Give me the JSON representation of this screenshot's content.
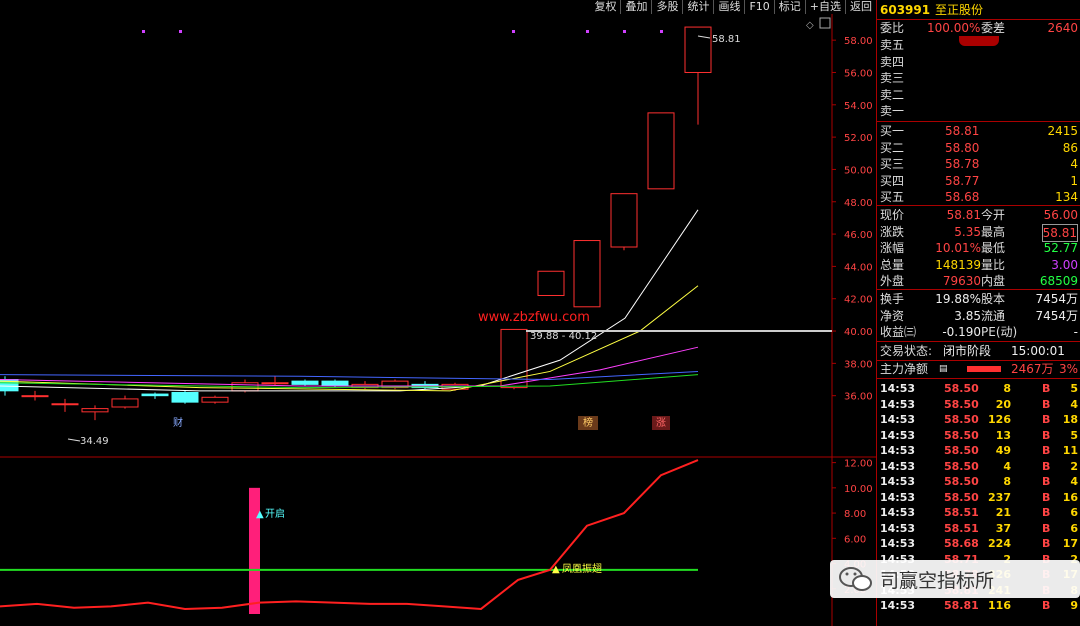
{
  "toolbar": [
    "复权",
    "叠加",
    "多股",
    "统计",
    "画线",
    "F10",
    "标记",
    "+自选",
    "返回"
  ],
  "stock": {
    "code": "603991",
    "name": "至正股份"
  },
  "order_ratio": {
    "label1": "委比",
    "value1": "100.00%",
    "label2": "委差",
    "value2": "2640"
  },
  "sell_levels": [
    "卖五",
    "卖四",
    "卖三",
    "卖二",
    "卖一"
  ],
  "buy_levels": [
    {
      "label": "买一",
      "price": "58.81",
      "vol": "2415"
    },
    {
      "label": "买二",
      "price": "58.80",
      "vol": "86"
    },
    {
      "label": "买三",
      "price": "58.78",
      "vol": "4"
    },
    {
      "label": "买四",
      "price": "58.77",
      "vol": "1"
    },
    {
      "label": "买五",
      "price": "58.68",
      "vol": "134"
    }
  ],
  "quote": [
    {
      "l1": "现价",
      "v1": "58.81",
      "l2": "今开",
      "v2": "56.00"
    },
    {
      "l1": "涨跌",
      "v1": "5.35",
      "l2": "最高",
      "v2": "58.81"
    },
    {
      "l1": "涨幅",
      "v1": "10.01%",
      "l2": "最低",
      "v2": "52.77"
    },
    {
      "l1": "总量",
      "v1": "148139",
      "l2": "量比",
      "v2": "3.00"
    },
    {
      "l1": "外盘",
      "v1": "79630",
      "l2": "内盘",
      "v2": "68509"
    }
  ],
  "fundamentals": [
    {
      "l1": "换手",
      "v1": "19.88%",
      "l2": "股本",
      "v2": "7454万"
    },
    {
      "l1": "净资",
      "v1": "3.85",
      "l2": "流通",
      "v2": "7454万"
    },
    {
      "l1": "收益㈢",
      "v1": "-0.190",
      "l2": "PE(动)",
      "v2": "-"
    }
  ],
  "trade_status": {
    "label": "交易状态:",
    "state": "闭市阶段",
    "time": "15:00:01"
  },
  "main_flow": {
    "label": "主力净额",
    "value": "2467万",
    "pct": "3%"
  },
  "ticks": [
    {
      "t": "14:53",
      "p": "58.50",
      "v": "8",
      "d": "B",
      "n": "5"
    },
    {
      "t": "14:53",
      "p": "58.50",
      "v": "20",
      "d": "B",
      "n": "4"
    },
    {
      "t": "14:53",
      "p": "58.50",
      "v": "126",
      "d": "B",
      "n": "18"
    },
    {
      "t": "14:53",
      "p": "58.50",
      "v": "13",
      "d": "B",
      "n": "5"
    },
    {
      "t": "14:53",
      "p": "58.50",
      "v": "49",
      "d": "B",
      "n": "11"
    },
    {
      "t": "14:53",
      "p": "58.50",
      "v": "4",
      "d": "B",
      "n": "2"
    },
    {
      "t": "14:53",
      "p": "58.50",
      "v": "8",
      "d": "B",
      "n": "4"
    },
    {
      "t": "14:53",
      "p": "58.50",
      "v": "237",
      "d": "B",
      "n": "16"
    },
    {
      "t": "14:53",
      "p": "58.51",
      "v": "21",
      "d": "B",
      "n": "6"
    },
    {
      "t": "14:53",
      "p": "58.51",
      "v": "37",
      "d": "B",
      "n": "6"
    },
    {
      "t": "14:53",
      "p": "58.68",
      "v": "224",
      "d": "B",
      "n": "17"
    },
    {
      "t": "14:53",
      "p": "58.71",
      "v": "2",
      "d": "B",
      "n": "2"
    },
    {
      "t": "14:53",
      "p": "58.79",
      "v": "326",
      "d": "B",
      "n": "17"
    },
    {
      "t": "14:53",
      "p": "58.81",
      "v": "241",
      "d": "B",
      "n": "8"
    },
    {
      "t": "14:53",
      "p": "58.81",
      "v": "116",
      "d": "B",
      "n": "9"
    }
  ],
  "price_axis": [
    "58.00",
    "56.00",
    "54.00",
    "52.00",
    "50.00",
    "48.00",
    "46.00",
    "44.00",
    "42.00",
    "40.00",
    "38.00",
    "36.00"
  ],
  "indicator_axis": [
    "12.00",
    "10.00",
    "8.00",
    "6.00",
    "4.00",
    "2.00"
  ],
  "chart_labels": {
    "high_label": "58.81",
    "low_label": "34.49",
    "range_label": "39.88 - 40.12",
    "site": "www.zbzfwu.com",
    "marker_cai": "财",
    "marker_bang": "榜",
    "marker_zhang": "涨",
    "signal_open": "开启",
    "signal_fly": "凤凰振翅"
  },
  "watermark": "司赢空指标所",
  "chart_data": {
    "type": "candlestick",
    "candles": [
      {
        "o": 37.0,
        "c": 36.3,
        "h": 37.2,
        "l": 36.0
      },
      {
        "o": 36.0,
        "c": 36.0,
        "h": 36.3,
        "l": 35.7
      },
      {
        "o": 35.5,
        "c": 35.5,
        "h": 35.8,
        "l": 35.0
      },
      {
        "o": 35.0,
        "c": 35.2,
        "h": 35.4,
        "l": 34.49
      },
      {
        "o": 35.3,
        "c": 35.8,
        "h": 36.0,
        "l": 35.2
      },
      {
        "o": 36.1,
        "c": 36.0,
        "h": 36.2,
        "l": 35.8
      },
      {
        "o": 36.2,
        "c": 35.6,
        "h": 36.3,
        "l": 35.5
      },
      {
        "o": 35.6,
        "c": 35.9,
        "h": 36.0,
        "l": 35.5
      },
      {
        "o": 36.3,
        "c": 36.8,
        "h": 37.0,
        "l": 36.2
      },
      {
        "o": 36.8,
        "c": 36.8,
        "h": 37.2,
        "l": 36.6
      },
      {
        "o": 36.9,
        "c": 36.7,
        "h": 37.0,
        "l": 36.6
      },
      {
        "o": 36.9,
        "c": 36.6,
        "h": 37.0,
        "l": 36.5
      },
      {
        "o": 36.5,
        "c": 36.7,
        "h": 36.9,
        "l": 36.4
      },
      {
        "o": 36.5,
        "c": 36.9,
        "h": 37.0,
        "l": 36.4
      },
      {
        "o": 36.7,
        "c": 36.5,
        "h": 36.9,
        "l": 36.4
      },
      {
        "o": 36.4,
        "c": 36.7,
        "h": 36.8,
        "l": 36.3
      },
      {
        "o": 36.5,
        "c": 40.1,
        "h": 40.12,
        "l": 36.4
      },
      {
        "o": 42.2,
        "c": 43.7,
        "h": 43.7,
        "l": 42.2
      },
      {
        "o": 41.5,
        "c": 45.6,
        "h": 45.6,
        "l": 41.5
      },
      {
        "o": 45.2,
        "c": 48.5,
        "h": 48.5,
        "l": 45.0
      },
      {
        "o": 48.8,
        "c": 53.5,
        "h": 53.5,
        "l": 48.8
      },
      {
        "o": 56.0,
        "c": 58.81,
        "h": 58.81,
        "l": 52.77
      }
    ],
    "indicator": [
      0.6,
      0.8,
      0.5,
      0.6,
      0.9,
      0.4,
      0.9,
      1.1,
      0.9,
      0.8,
      0.7,
      0.5,
      0.4,
      2.7,
      3.5,
      7.0,
      8.0,
      11.0,
      12.2
    ],
    "threshold": 3.5,
    "ylim": [
      34,
      59
    ],
    "indicator_ylim": [
      0,
      13
    ]
  }
}
